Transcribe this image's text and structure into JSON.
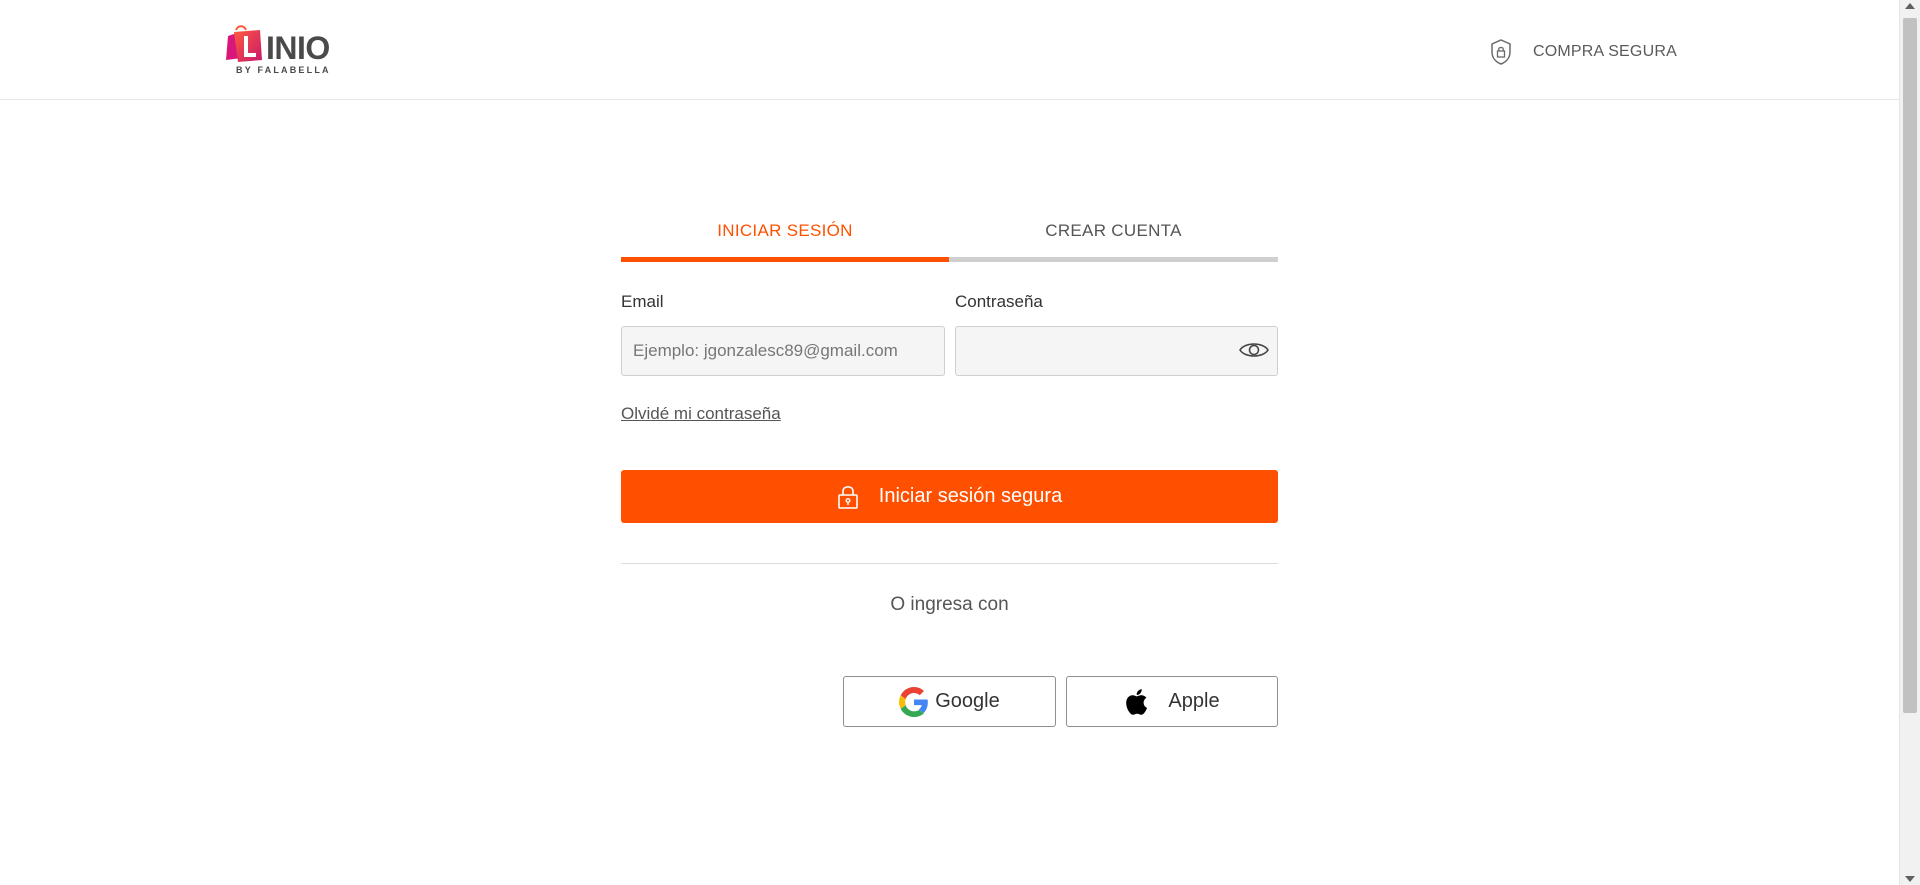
{
  "header": {
    "logo_word": "INIO",
    "logo_sub": "BY FALABELLA",
    "secure_label": "COMPRA SEGURA"
  },
  "tabs": [
    {
      "label": "INICIAR SESIÓN",
      "active": true
    },
    {
      "label": "CREAR CUENTA",
      "active": false
    }
  ],
  "form": {
    "email_label": "Email",
    "email_placeholder": "Ejemplo: jgonzalesc89@gmail.com",
    "email_value": "",
    "password_label": "Contraseña",
    "password_value": "",
    "forgot_link": "Olvidé mi contraseña",
    "submit_label": "Iniciar sesión segura"
  },
  "social": {
    "divider_text": "O ingresa con",
    "google_label": "Google",
    "apple_label": "Apple"
  },
  "colors": {
    "accent": "#ff5000",
    "inactive_tab": "#cfcfcf",
    "logo_pink": "#e8147d"
  }
}
